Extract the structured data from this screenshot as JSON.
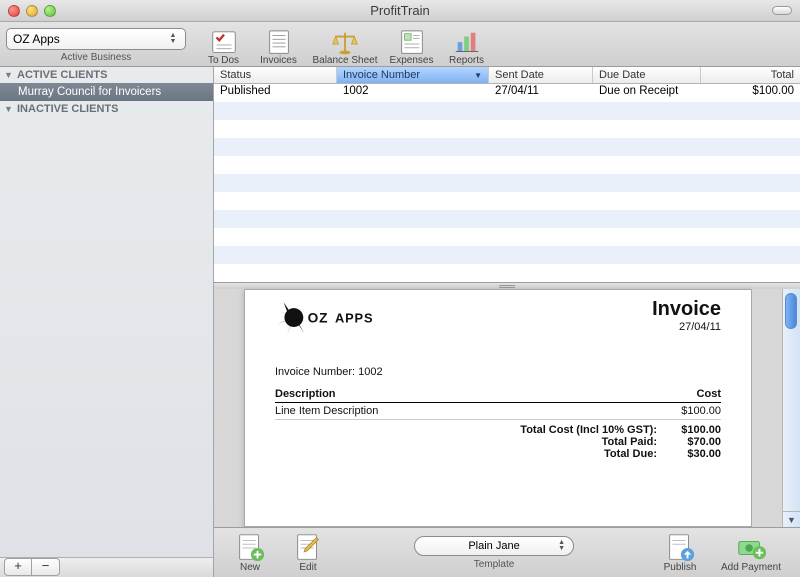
{
  "window": {
    "title": "ProfitTrain"
  },
  "business_select": {
    "value": "OZ Apps",
    "label": "Active Business"
  },
  "toolbar": [
    {
      "key": "todos",
      "label": "To Dos",
      "icon": "checklist-icon"
    },
    {
      "key": "invoices",
      "label": "Invoices",
      "icon": "invoice-icon"
    },
    {
      "key": "balance",
      "label": "Balance Sheet",
      "icon": "scale-icon"
    },
    {
      "key": "expenses",
      "label": "Expenses",
      "icon": "expenses-icon"
    },
    {
      "key": "reports",
      "label": "Reports",
      "icon": "barchart-icon"
    }
  ],
  "sidebar": {
    "groups": [
      {
        "title": "ACTIVE CLIENTS",
        "expanded": true,
        "items": [
          "Murray Council for Invoicers"
        ]
      },
      {
        "title": "INACTIVE CLIENTS",
        "expanded": true,
        "items": []
      }
    ]
  },
  "table": {
    "columns": [
      {
        "key": "status",
        "label": "Status"
      },
      {
        "key": "number",
        "label": "Invoice Number",
        "sorted": true
      },
      {
        "key": "sent",
        "label": "Sent Date"
      },
      {
        "key": "due",
        "label": "Due Date"
      },
      {
        "key": "total",
        "label": "Total"
      }
    ],
    "rows": [
      {
        "status": "Published",
        "number": "1002",
        "sent": "27/04/11",
        "due": "Due on Receipt",
        "total": "$100.00"
      }
    ]
  },
  "invoice_preview": {
    "logo_text": "OZ APPS",
    "title": "Invoice",
    "date": "27/04/11",
    "number_label": "Invoice Number: 1002",
    "columns": {
      "desc": "Description",
      "cost": "Cost"
    },
    "line_items": [
      {
        "desc": "Line Item Description",
        "cost": "$100.00"
      }
    ],
    "totals": [
      {
        "label": "Total Cost (Incl 10% GST):",
        "value": "$100.00"
      },
      {
        "label": "Total Paid:",
        "value": "$70.00"
      },
      {
        "label": "Total Due:",
        "value": "$30.00"
      }
    ]
  },
  "template_select": {
    "value": "Plain Jane",
    "label": "Template"
  },
  "actions": {
    "new": "New",
    "edit": "Edit",
    "publish": "Publish",
    "add_payment": "Add Payment"
  }
}
